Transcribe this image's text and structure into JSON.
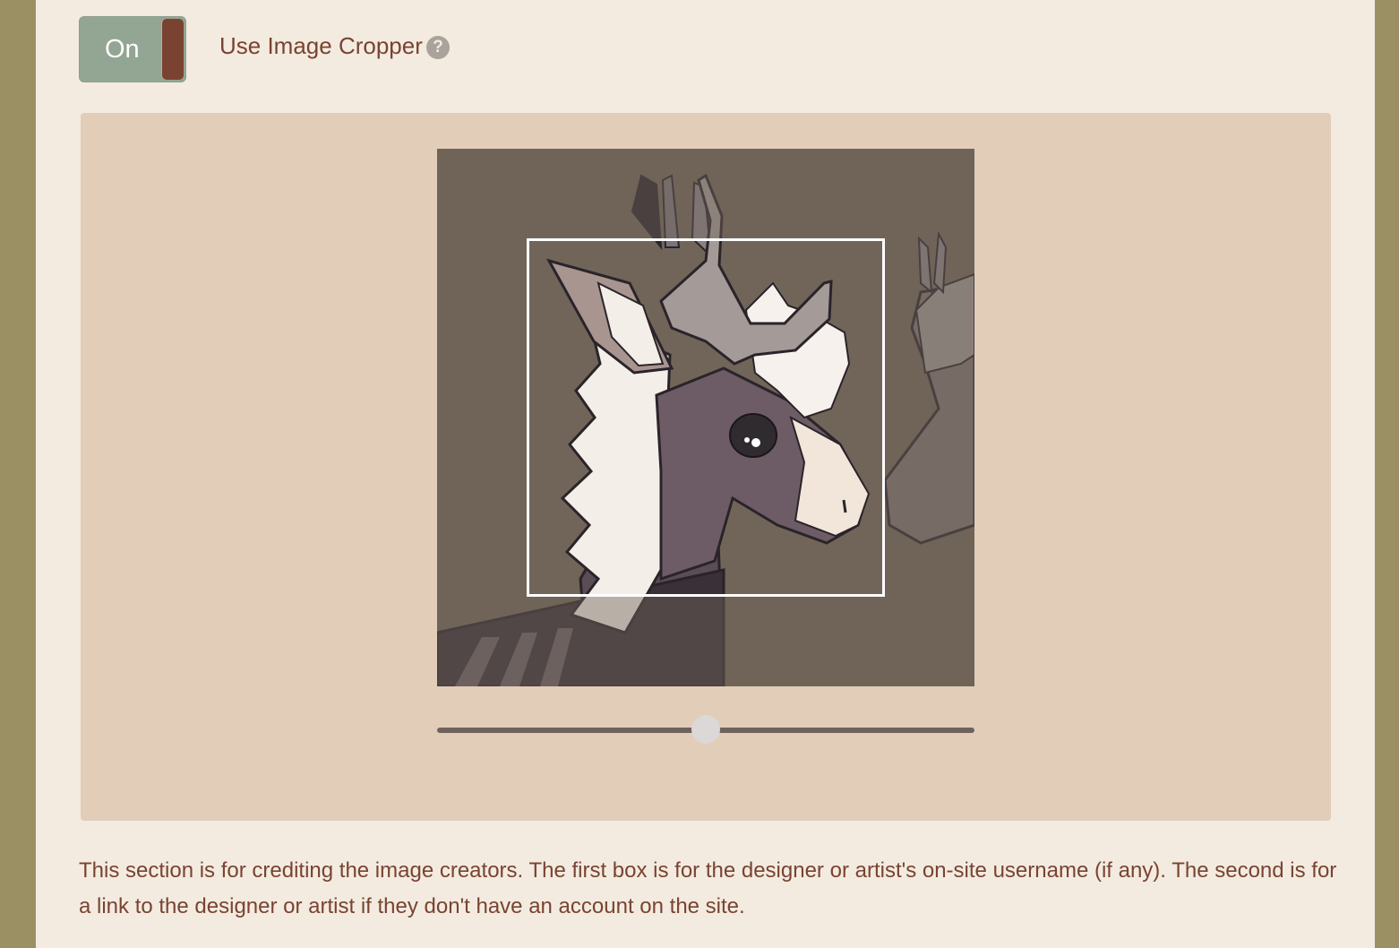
{
  "cropper_toggle": {
    "state_label": "On",
    "is_on": true
  },
  "cropper_setting": {
    "label": "Use Image Cropper",
    "help_icon": "question-circle-icon"
  },
  "image": {
    "subject": "drawing of a horned deer-like creature with white mane"
  },
  "zoom": {
    "value_fraction": 0.5
  },
  "credits": {
    "description": "This section is for crediting the image creators. The first box is for the designer or artist's on-site username (if any). The second is for a link to the designer or artist if they don't have an account on the site."
  },
  "colors": {
    "page_bg": "#9a9064",
    "panel_bg": "#f3ebe0",
    "toggle_on": "#93a593",
    "knob": "#7a4331",
    "text": "#7a4331",
    "cropper_bg": "#e2cdb9"
  }
}
